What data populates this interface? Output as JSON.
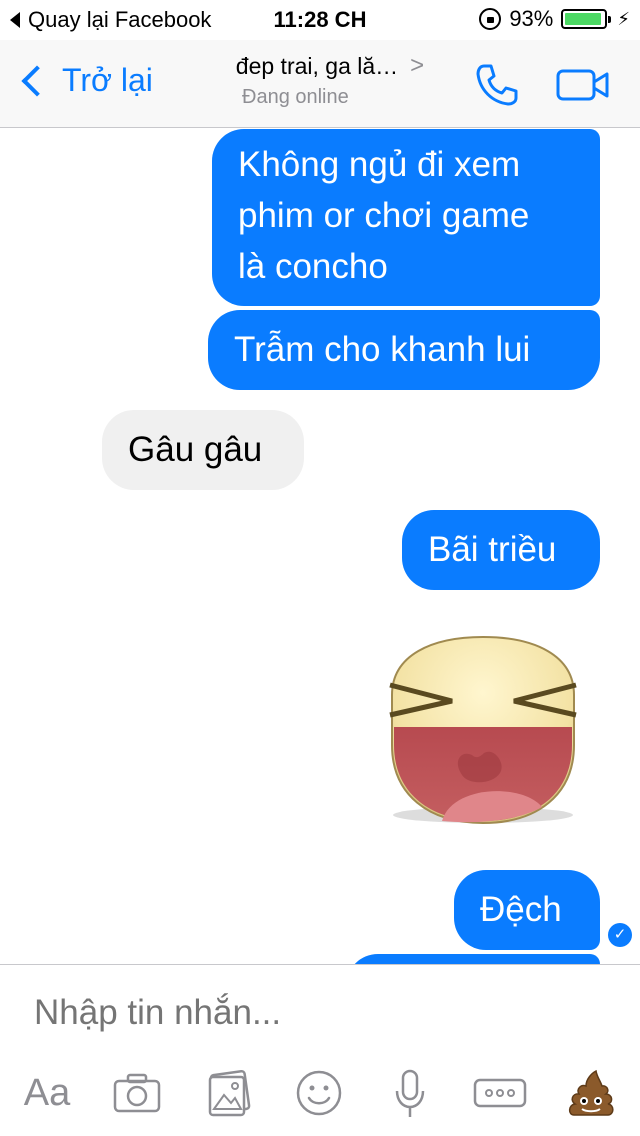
{
  "status_bar": {
    "back_app": "Quay lại Facebook",
    "time": "11:28 CH",
    "battery_percent": "93%",
    "battery_level": 0.93
  },
  "nav": {
    "back_label": "Trở lại",
    "contact_name": "đep trai, ga lă…",
    "contact_status": "Đang online",
    "chevron": ">"
  },
  "messages": [
    {
      "sender": "me",
      "text": "Không ngủ đi xem phim or chơi game là concho"
    },
    {
      "sender": "me",
      "text": "Trẫm cho khanh lui"
    },
    {
      "sender": "them",
      "text": "Gâu gâu"
    },
    {
      "sender": "me",
      "text": "Bãi triều"
    },
    {
      "sender": "me",
      "type": "sticker",
      "sticker": "laughing-face-sticker"
    },
    {
      "sender": "me",
      "text": "Đệch"
    }
  ],
  "message_lines": {
    "m1_l1": "Không ngủ đi xem",
    "m1_l2": "phim or chơi game",
    "m1_l3": "là concho"
  },
  "composer": {
    "placeholder": "Nhập tin nhắn...",
    "aa_label": "Aa",
    "tools": [
      "aa-icon",
      "camera-icon",
      "gallery-icon",
      "emoji-icon",
      "microphone-icon",
      "more-icon",
      "poop-emoji-icon"
    ]
  },
  "colors": {
    "accent": "#0a7cff",
    "incoming_bubble": "#f0f0f0",
    "battery": "#4cd964"
  }
}
